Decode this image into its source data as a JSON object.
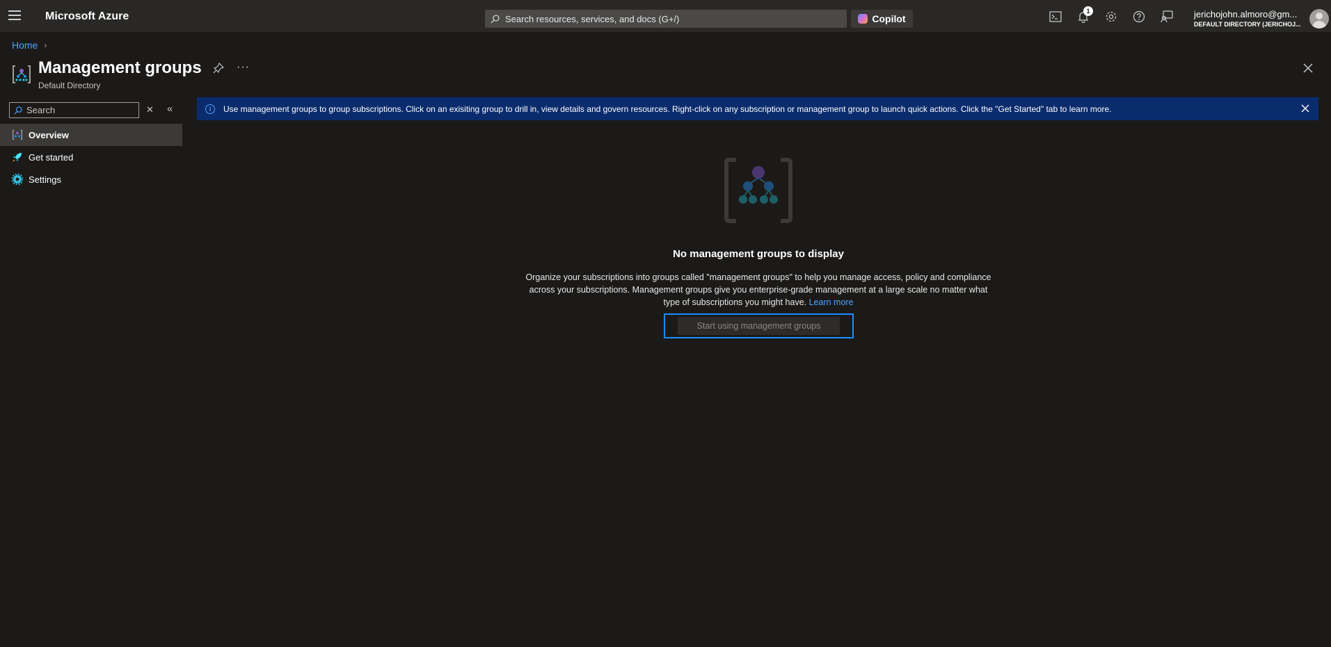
{
  "topbar": {
    "brand": "Microsoft Azure",
    "search_placeholder": "Search resources, services, and docs (G+/)",
    "copilot_label": "Copilot",
    "notification_count": "1",
    "user_name": "jerichojohn.almoro@gm...",
    "user_directory": "DEFAULT DIRECTORY (JERICHOJ..."
  },
  "breadcrumb": {
    "home": "Home"
  },
  "header": {
    "title": "Management groups",
    "subtitle": "Default Directory",
    "more": "···"
  },
  "sidebar": {
    "search_placeholder": "Search",
    "items": [
      {
        "label": "Overview",
        "icon": "management-groups-icon",
        "active": true
      },
      {
        "label": "Get started",
        "icon": "rocket-icon",
        "active": false
      },
      {
        "label": "Settings",
        "icon": "gear-icon",
        "active": false
      }
    ]
  },
  "banner": {
    "text": "Use management groups to group subscriptions. Click on an exisiting group to drill in, view details and govern resources. Right-click on any subscription or management group to launch quick actions. Click the \"Get Started\" tab to learn more."
  },
  "empty_state": {
    "title": "No management groups to display",
    "description": "Organize your subscriptions into groups called \"management groups\" to help you manage access, policy and compliance across your subscriptions. Management groups give you enterprise-grade management at a large scale no matter what type of subscriptions you might have.",
    "learn_more": "Learn more",
    "button_label": "Start using management groups"
  },
  "colors": {
    "background": "#1b1a19",
    "topbar": "#292827",
    "banner": "#0a2c6d",
    "link": "#4ea3ff",
    "focus": "#1a8cff"
  }
}
